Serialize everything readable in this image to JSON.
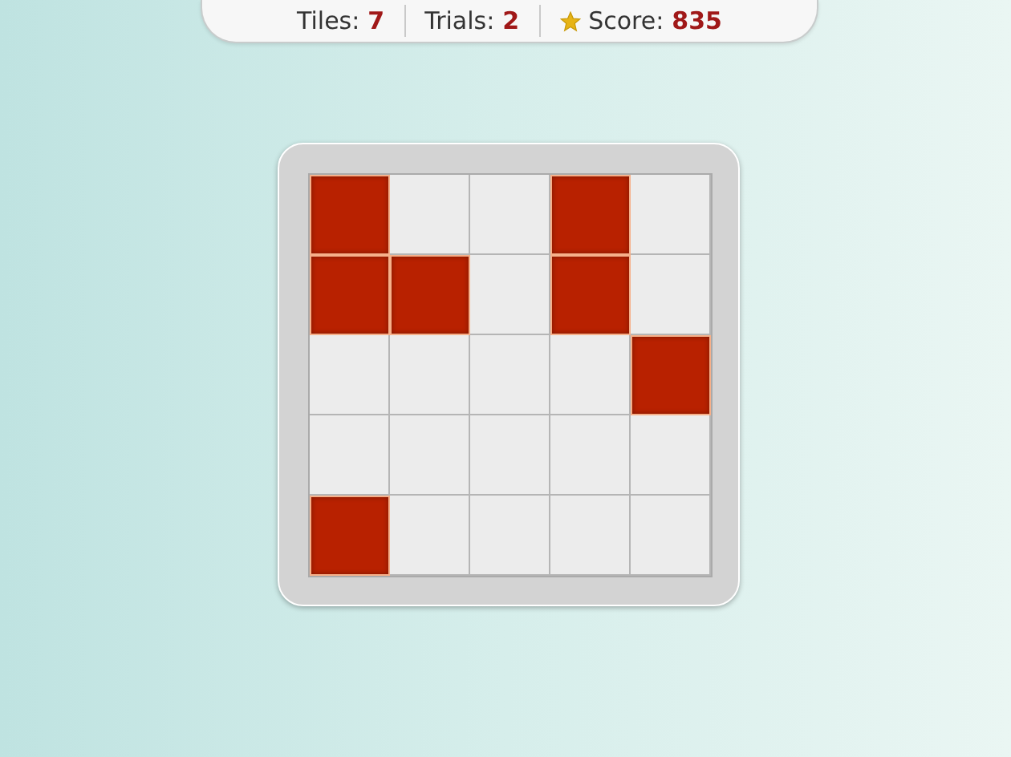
{
  "stats": [
    {
      "label": "Tiles:",
      "value": "7",
      "star": false
    },
    {
      "label": "Trials:",
      "value": "2",
      "star": false
    },
    {
      "label": "Score:",
      "value": "835",
      "star": true
    }
  ],
  "board": {
    "rows": [
      [
        {
          "on": true
        },
        {
          "on": false
        },
        {
          "on": false
        },
        {
          "on": true
        },
        {
          "on": false
        }
      ],
      [
        {
          "on": true
        },
        {
          "on": true
        },
        {
          "on": false
        },
        {
          "on": true
        },
        {
          "on": false
        }
      ],
      [
        {
          "on": false
        },
        {
          "on": false
        },
        {
          "on": false
        },
        {
          "on": false
        },
        {
          "on": true
        }
      ],
      [
        {
          "on": false
        },
        {
          "on": false
        },
        {
          "on": false
        },
        {
          "on": false
        },
        {
          "on": false
        }
      ],
      [
        {
          "on": true
        },
        {
          "on": false
        },
        {
          "on": false
        },
        {
          "on": false
        },
        {
          "on": false
        }
      ]
    ]
  }
}
